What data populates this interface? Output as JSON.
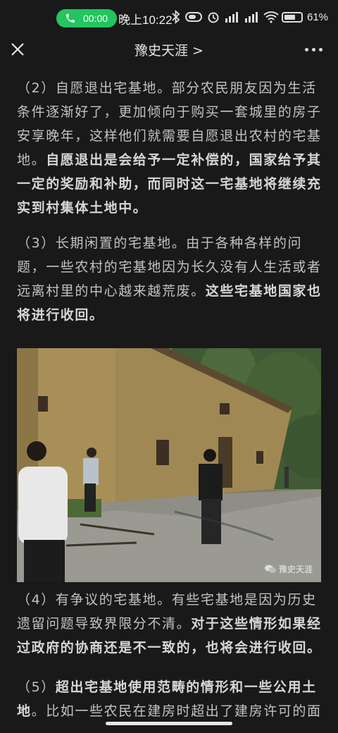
{
  "status_bar": {
    "call_timer": "00:00",
    "time": "晚上10:22",
    "battery": "61%"
  },
  "nav": {
    "title": "豫史天涯 >"
  },
  "article": {
    "p2_a": "（2）自愿退出宅基地。部分农民朋友因为生活条件逐渐好了，更加倾向于购买一套城里的房子安享晚年，这样他们就需要自愿退出农村的宅基地。",
    "p2_b": "自愿退出是会给予一定补偿的，国家给予其一定的奖励和补助，而同时这一宅基地将继续充实到村集体土地中。",
    "p3_a": "（3）长期闲置的宅基地。由于各种各样的问题，一些农村的宅基地因为长久没有人生活或者远离村里的中心越来越荒废。",
    "p3_b": "这些宅基地国家也将进行收回。",
    "p4_a": "（4）有争议的宅基地。有些宅基地是因为历史遗留问题导致界限分不清。",
    "p4_b": "对于这些情形如果经过政府的协商还是不一致的，也将会进行收回。",
    "p5_a": "（5）",
    "p5_b": "超出宅基地使用范畴的情形和一些公用土地",
    "p5_c": "。比如一些农民在建房时超出了建房许可的面"
  },
  "image": {
    "watermark": "豫史天涯"
  }
}
